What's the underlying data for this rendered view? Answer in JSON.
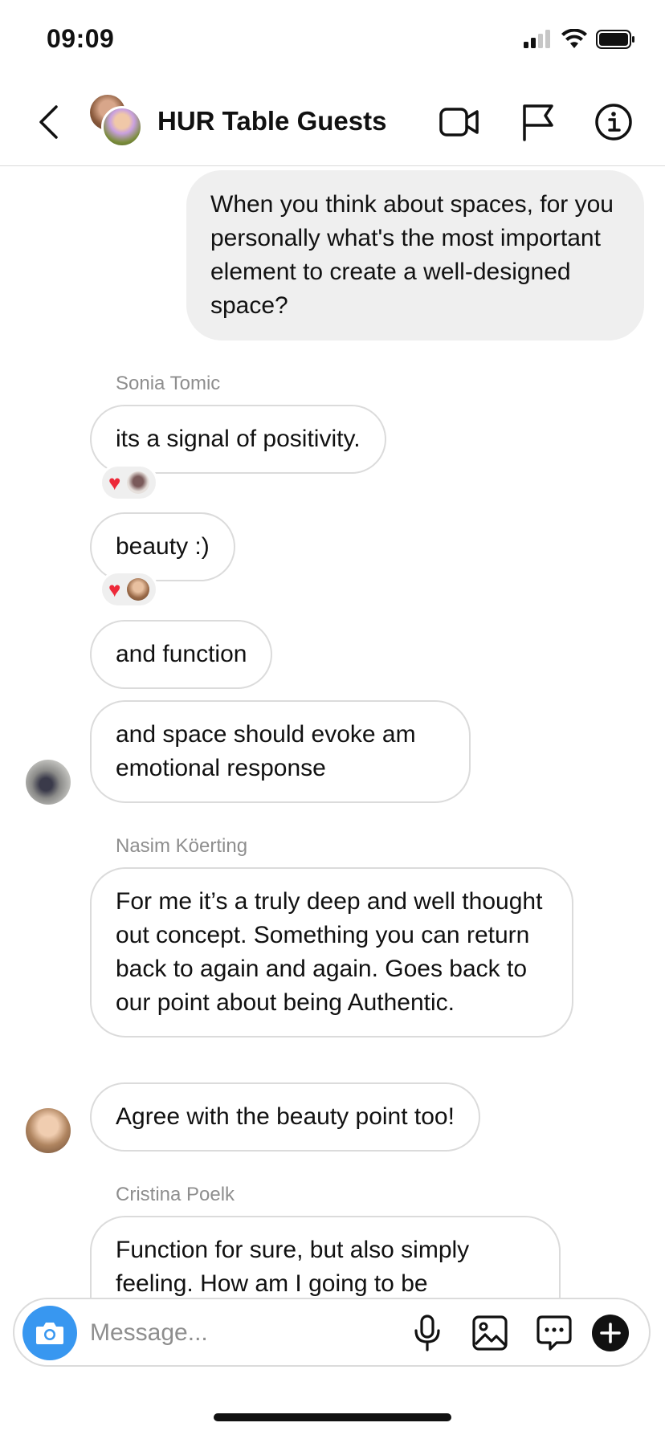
{
  "status_bar": {
    "time": "09:09"
  },
  "header": {
    "title": "HUR Table Guests"
  },
  "messages": {
    "outgoing_1": "When you think about spaces, for you personally what's the most important element to create a well-designed space?",
    "sender_1": "Sonia Tomic",
    "sonia_1": "its a signal of positivity.",
    "sonia_2": "beauty :)",
    "sonia_3": "and function",
    "sonia_4": "and space should evoke am emotional response",
    "sender_2": "Nasim Köerting",
    "nasim_1": "For me it’s a truly deep and well thought out concept. Something you can return back to again and again. Goes back to our point about being Authentic.",
    "nasim_2": "Agree with the beauty point too!",
    "sender_3": "Cristina Poelk",
    "cristina_1": "Function for sure, but also simply feeling. How am I going to be"
  },
  "composer": {
    "placeholder": "Message..."
  },
  "colors": {
    "accent": "#3897f0",
    "heart": "#ed2939",
    "bubble_out": "#efefef",
    "border": "#dbdbdb",
    "meta_text": "#8e8e8e"
  },
  "icons": {
    "header": [
      "back-arrow-icon",
      "video-call-icon",
      "flag-icon",
      "info-icon"
    ],
    "composer": [
      "camera-icon",
      "microphone-icon",
      "gallery-icon",
      "sticker-chat-icon",
      "plus-icon"
    ]
  }
}
